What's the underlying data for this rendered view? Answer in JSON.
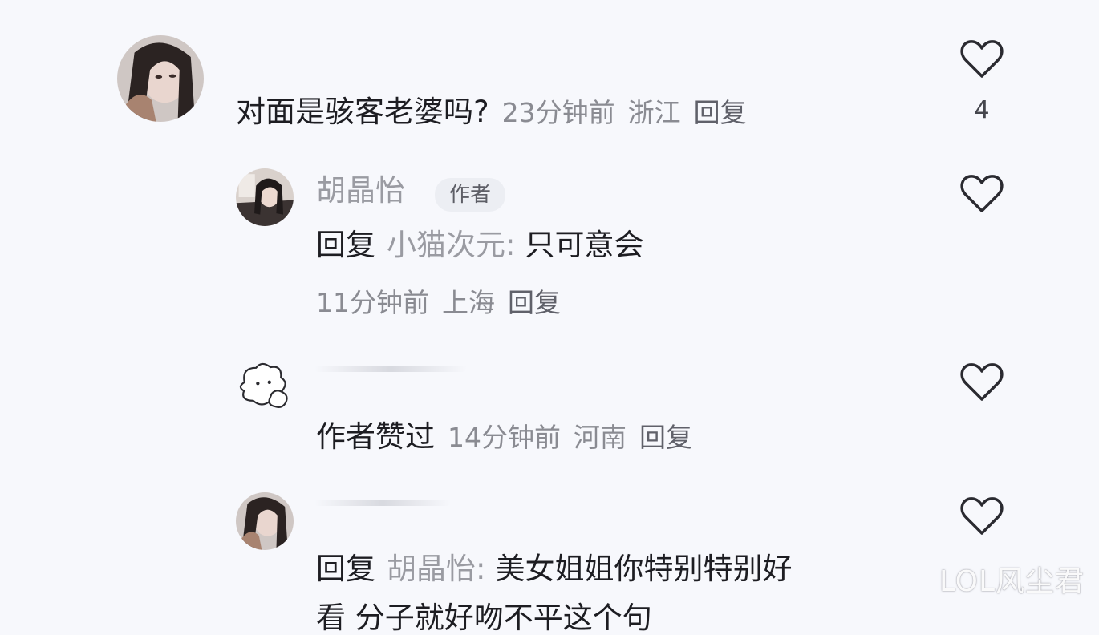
{
  "comment1": {
    "text": "对面是骇客老婆吗?",
    "time": "23分钟前",
    "region": "浙江",
    "reply": "回复",
    "likes": "4"
  },
  "comment2": {
    "username": "胡晶怡",
    "badge": "作者",
    "reply_prefix": "回复",
    "mention": "小猫次元:",
    "text": "只可意会",
    "time": "11分钟前",
    "region": "上海",
    "reply": "回复"
  },
  "comment3": {
    "text": "作者赞过",
    "time": "14分钟前",
    "region": "河南",
    "reply": "回复"
  },
  "comment4": {
    "reply_prefix": "回复",
    "mention": "胡晶怡:",
    "text": "美女姐姐你特别特别好",
    "text_line2": "看  分子就好吻不平这个句"
  },
  "watermark": "LOL风尘君",
  "colors": {
    "background": "#f7f8fc",
    "primary_text": "#1d1d22",
    "secondary_text": "#8a8b92",
    "heart_stroke": "#2a2a30"
  }
}
